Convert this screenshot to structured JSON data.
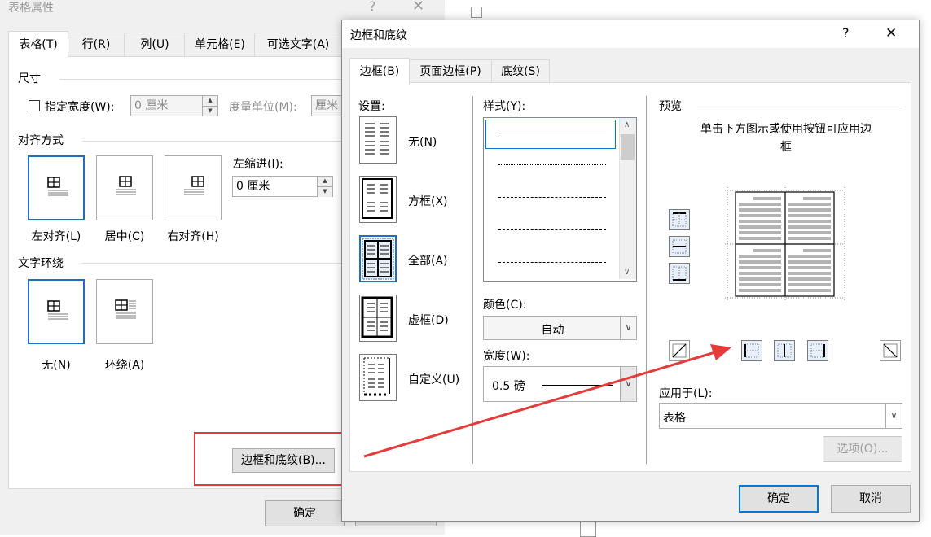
{
  "table_properties": {
    "title": "表格属性",
    "help": "?",
    "close": "✕",
    "tabs": [
      "表格(T)",
      "行(R)",
      "列(U)",
      "单元格(E)",
      "可选文字(A)"
    ],
    "size_group": "尺寸",
    "preferred_width_label": "指定宽度(W):",
    "preferred_width_value": "0 厘米",
    "measure_in_label": "度量单位(M):",
    "measure_in_value": "厘米",
    "alignment_group": "对齐方式",
    "alignment_options": [
      "左对齐(L)",
      "居中(C)",
      "右对齐(H)"
    ],
    "indent_label": "左缩进(I):",
    "indent_value": "0 厘米",
    "wrapping_group": "文字环绕",
    "wrapping_options": [
      "无(N)",
      "环绕(A)"
    ],
    "borders_button": "边框和底纹(B)...",
    "ok": "确定"
  },
  "borders_dialog": {
    "title": "边框和底纹",
    "help": "?",
    "close": "✕",
    "tabs": [
      "边框(B)",
      "页面边框(P)",
      "底纹(S)"
    ],
    "setting_label": "设置:",
    "settings": [
      "无(N)",
      "方框(X)",
      "全部(A)",
      "虚框(D)",
      "自定义(U)"
    ],
    "style_label": "样式(Y):",
    "color_label": "颜色(C):",
    "color_value": "自动",
    "width_label": "宽度(W):",
    "width_value": "0.5 磅",
    "preview_label": "预览",
    "preview_hint": "单击下方图示或使用按钮可应用边框",
    "apply_to_label": "应用于(L):",
    "apply_to_value": "表格",
    "options_button": "选项(O)...",
    "ok": "确定",
    "cancel": "取消"
  },
  "colors": {
    "accent": "#0078d7",
    "annotation": "#e63b3b"
  }
}
